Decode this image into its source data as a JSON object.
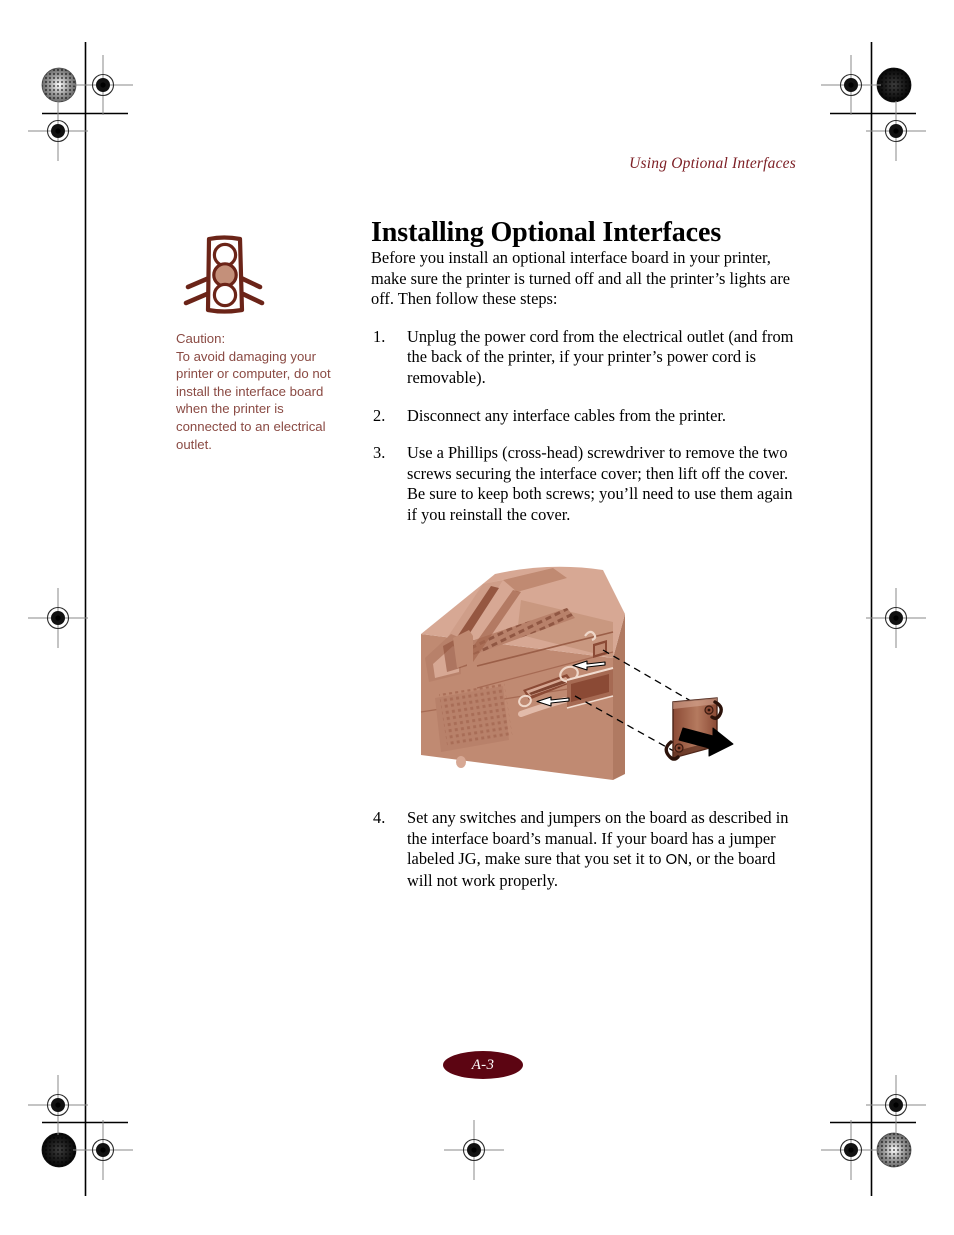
{
  "document": {
    "running_head": "Using Optional Interfaces",
    "title": "Installing Optional Interfaces",
    "folio": "A-3"
  },
  "body": {
    "intro": "Before you install an optional interface board in your printer, make sure the printer is turned off and all the printer’s lights are off. Then follow these steps:",
    "steps": [
      {
        "number": "1.",
        "text": "Unplug the power cord from the electrical outlet (and from the back of the printer, if your printer’s power cord is removable)."
      },
      {
        "number": "2.",
        "text": "Disconnect any interface cables from the printer."
      },
      {
        "number": "3.",
        "text": "Use a Phillips (cross-head) screwdriver to remove the two screws securing the interface cover; then lift off the cover. Be sure to keep both screws; you’ll need to use them again if you reinstall the cover."
      },
      {
        "number": "4.",
        "text_before": "Set any switches and jumpers on the board as described in the interface board’s manual. If your board has a jumper labeled JG, make sure that you set it to ",
        "emphasis": "ON",
        "text_after": ", or the board will not work properly."
      }
    ]
  },
  "caution": {
    "icon_name": "traffic-light-caution-icon",
    "label": "Caution:",
    "text": "To avoid damaging your printer or computer, do not install the interface board when the printer is connected to an electrical outlet."
  },
  "figure": {
    "name": "printer-interface-cover-removal-illustration",
    "description": "Rear three-quarter view of a printer with the interface cover plate pulled away; two dashed alignment lines lead from the cover slot to the removed plate, and a black arrow shows the removal direction."
  },
  "colors": {
    "running_head": "#7d2026",
    "caution_text": "#8a4a43",
    "caution_icon_outline": "#6b2418",
    "caution_icon_fill": "#c4907a",
    "folio_oval": "#5c0512",
    "folio_text": "#ffffff",
    "illustration_light": "#d7a894",
    "illustration_mid": "#c08a72",
    "illustration_dark": "#a66a53",
    "illustration_darkest": "#8b4a35",
    "page_background": "#ffffff",
    "crop_mark": "#000000",
    "registration_mark": "#7a7a7a"
  },
  "prepress": {
    "crop_marks": "trim and registration marks on all four corners and page edges",
    "halftone_dots": [
      "halftone-dot-top-left",
      "halftone-dot-top-right",
      "halftone-dot-bottom-left",
      "halftone-dot-bottom-right"
    ],
    "registration_targets": [
      "reg-top-left",
      "reg-top-left-inner",
      "reg-top-right",
      "reg-top-right-inner",
      "reg-mid-left",
      "reg-mid-right",
      "reg-bottom-left",
      "reg-bottom-left-inner",
      "reg-bottom-right",
      "reg-bottom-right-inner",
      "reg-bottom-center"
    ]
  }
}
